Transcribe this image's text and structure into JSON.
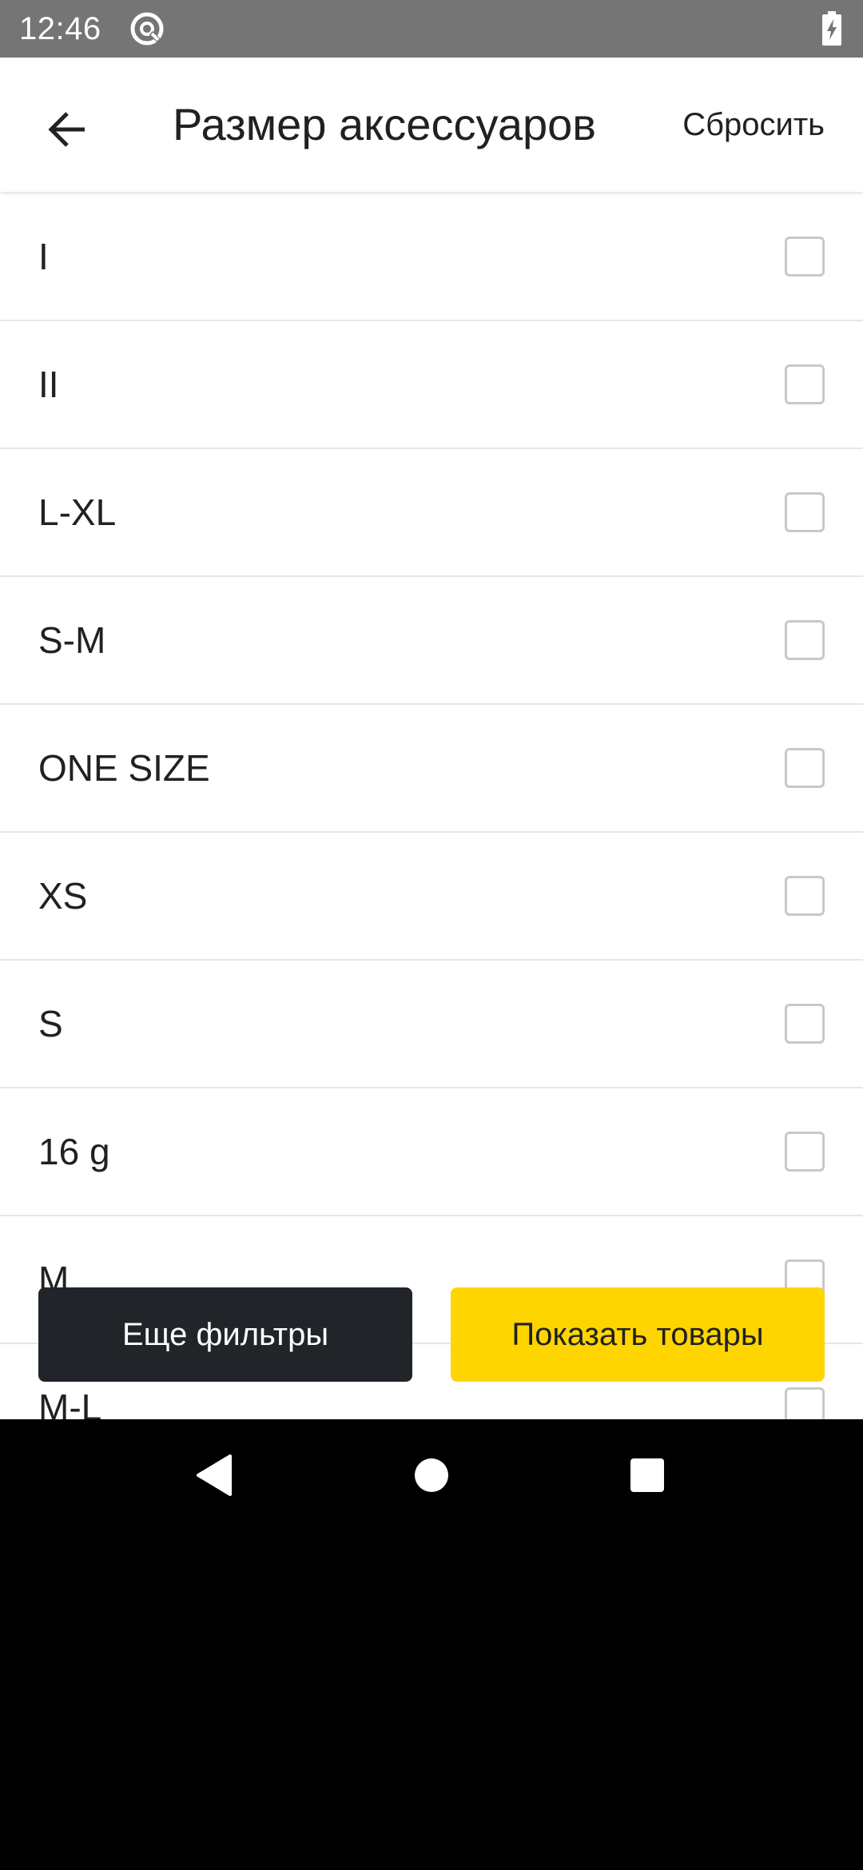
{
  "status_bar": {
    "time": "12:46",
    "app_icon": "at-sign-icon",
    "battery_icon": "battery-charging-icon"
  },
  "header": {
    "back_icon": "arrow-left-icon",
    "title": "Размер аксессуаров",
    "reset_label": "Сбросить"
  },
  "sizes": [
    {
      "label": "I",
      "checked": false
    },
    {
      "label": "II",
      "checked": false
    },
    {
      "label": "L-XL",
      "checked": false
    },
    {
      "label": "S-M",
      "checked": false
    },
    {
      "label": "ONE SIZE",
      "checked": false
    },
    {
      "label": "XS",
      "checked": false
    },
    {
      "label": "S",
      "checked": false
    },
    {
      "label": "16 g",
      "checked": false
    },
    {
      "label": "M",
      "checked": false
    },
    {
      "label": "M-L",
      "checked": false
    }
  ],
  "actions": {
    "more_filters_label": "Еще фильтры",
    "show_products_label": "Показать товары"
  },
  "colors": {
    "status_bar": "#757575",
    "primary_button": "#ffd500",
    "secondary_button": "#212529",
    "checkbox_border": "#c8c8c8",
    "divider": "#e6e6e6"
  },
  "nav_bar": {
    "back_icon": "triangle-back-icon",
    "home_icon": "circle-home-icon",
    "recents_icon": "square-recents-icon"
  }
}
